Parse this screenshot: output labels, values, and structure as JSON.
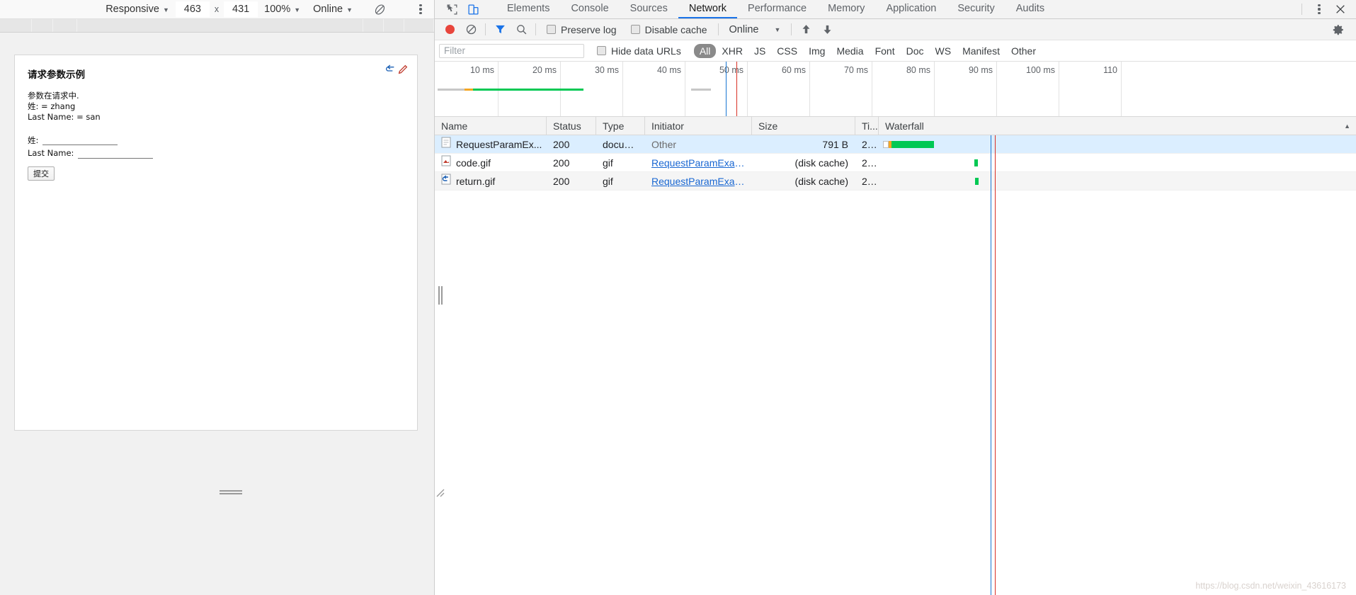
{
  "device_toolbar": {
    "device_label": "Responsive",
    "width": "463",
    "height": "431",
    "zoom": "100%",
    "throttle": "Online",
    "rotate_icon": "rotate-icon",
    "menu_icon": "kebab-menu-icon"
  },
  "page": {
    "heading": "请求参数示例",
    "paragraph_lines": [
      "参数在请求中.",
      "姓:  = zhang",
      "Last Name: = san"
    ],
    "fields": [
      {
        "label": "姓:",
        "value": "",
        "placeholder": ""
      },
      {
        "label": "Last Name:",
        "value": "",
        "placeholder": ""
      }
    ],
    "submit_label": "提交",
    "edit_icon": "pencil-icon",
    "link_icon": "return-link-icon"
  },
  "devtools": {
    "tabs": [
      {
        "label": "Elements",
        "active": false
      },
      {
        "label": "Console",
        "active": false
      },
      {
        "label": "Sources",
        "active": false
      },
      {
        "label": "Network",
        "active": true
      },
      {
        "label": "Performance",
        "active": false
      },
      {
        "label": "Memory",
        "active": false
      },
      {
        "label": "Application",
        "active": false
      },
      {
        "label": "Security",
        "active": false
      },
      {
        "label": "Audits",
        "active": false
      }
    ],
    "inspect_icon": "inspect-cursor-icon",
    "device_toggle_icon": "device-toolbar-icon",
    "more_icon": "kebab-menu-icon",
    "close_icon": "close-icon",
    "settings_icon": "gear-icon"
  },
  "network_toolbar": {
    "record_icon": "record-button-icon",
    "clear_icon": "clear-icon",
    "filter_icon": "filter-funnel-icon",
    "search_icon": "search-icon",
    "preserve_log": {
      "label": "Preserve log",
      "checked": false
    },
    "disable_cache": {
      "label": "Disable cache",
      "checked": false
    },
    "throttle_value": "Online",
    "import_icon": "upload-arrow-icon",
    "export_icon": "download-arrow-icon"
  },
  "filter_bar": {
    "filter_placeholder": "Filter",
    "filter_value": "",
    "hide_data_urls": {
      "label": "Hide data URLs",
      "checked": false
    },
    "types": [
      {
        "label": "All",
        "active": true
      },
      {
        "label": "XHR",
        "active": false
      },
      {
        "label": "JS",
        "active": false
      },
      {
        "label": "CSS",
        "active": false
      },
      {
        "label": "Img",
        "active": false
      },
      {
        "label": "Media",
        "active": false
      },
      {
        "label": "Font",
        "active": false
      },
      {
        "label": "Doc",
        "active": false
      },
      {
        "label": "WS",
        "active": false
      },
      {
        "label": "Manifest",
        "active": false
      },
      {
        "label": "Other",
        "active": false
      }
    ]
  },
  "overview": {
    "ticks": [
      "10 ms",
      "20 ms",
      "30 ms",
      "40 ms",
      "50 ms",
      "60 ms",
      "70 ms",
      "80 ms",
      "90 ms",
      "100 ms",
      "110"
    ]
  },
  "requests_table": {
    "columns": [
      "Name",
      "Status",
      "Type",
      "Initiator",
      "Size",
      "Ti...",
      "Waterfall"
    ],
    "sort_indicator": "▲",
    "rows": [
      {
        "icon": "document-file-icon",
        "name": "RequestParamEx...",
        "status": "200",
        "type": "docum...",
        "initiator": "Other",
        "initiator_is_link": false,
        "size": "791 B",
        "time": "2...",
        "selected": true
      },
      {
        "icon": "gif-image-icon",
        "name": "code.gif",
        "status": "200",
        "type": "gif",
        "initiator": "RequestParamExam...",
        "initiator_is_link": true,
        "size": "(disk cache)",
        "time": "2 ...",
        "selected": false
      },
      {
        "icon": "gif-image-icon",
        "name": "return.gif",
        "status": "200",
        "type": "gif",
        "initiator": "RequestParamExam...",
        "initiator_is_link": true,
        "size": "(disk cache)",
        "time": "2 ...",
        "selected": false
      }
    ]
  },
  "watermark": "https://blog.csdn.net/weixin_43616173",
  "colors": {
    "accent_blue": "#1a73e8",
    "record_red": "#e8453c",
    "waterfall_green": "#00c853",
    "waterfall_orange": "#f5a623",
    "dom_content_blue": "#1976d2",
    "load_red": "#d93025",
    "link_blue": "#1967d2"
  }
}
